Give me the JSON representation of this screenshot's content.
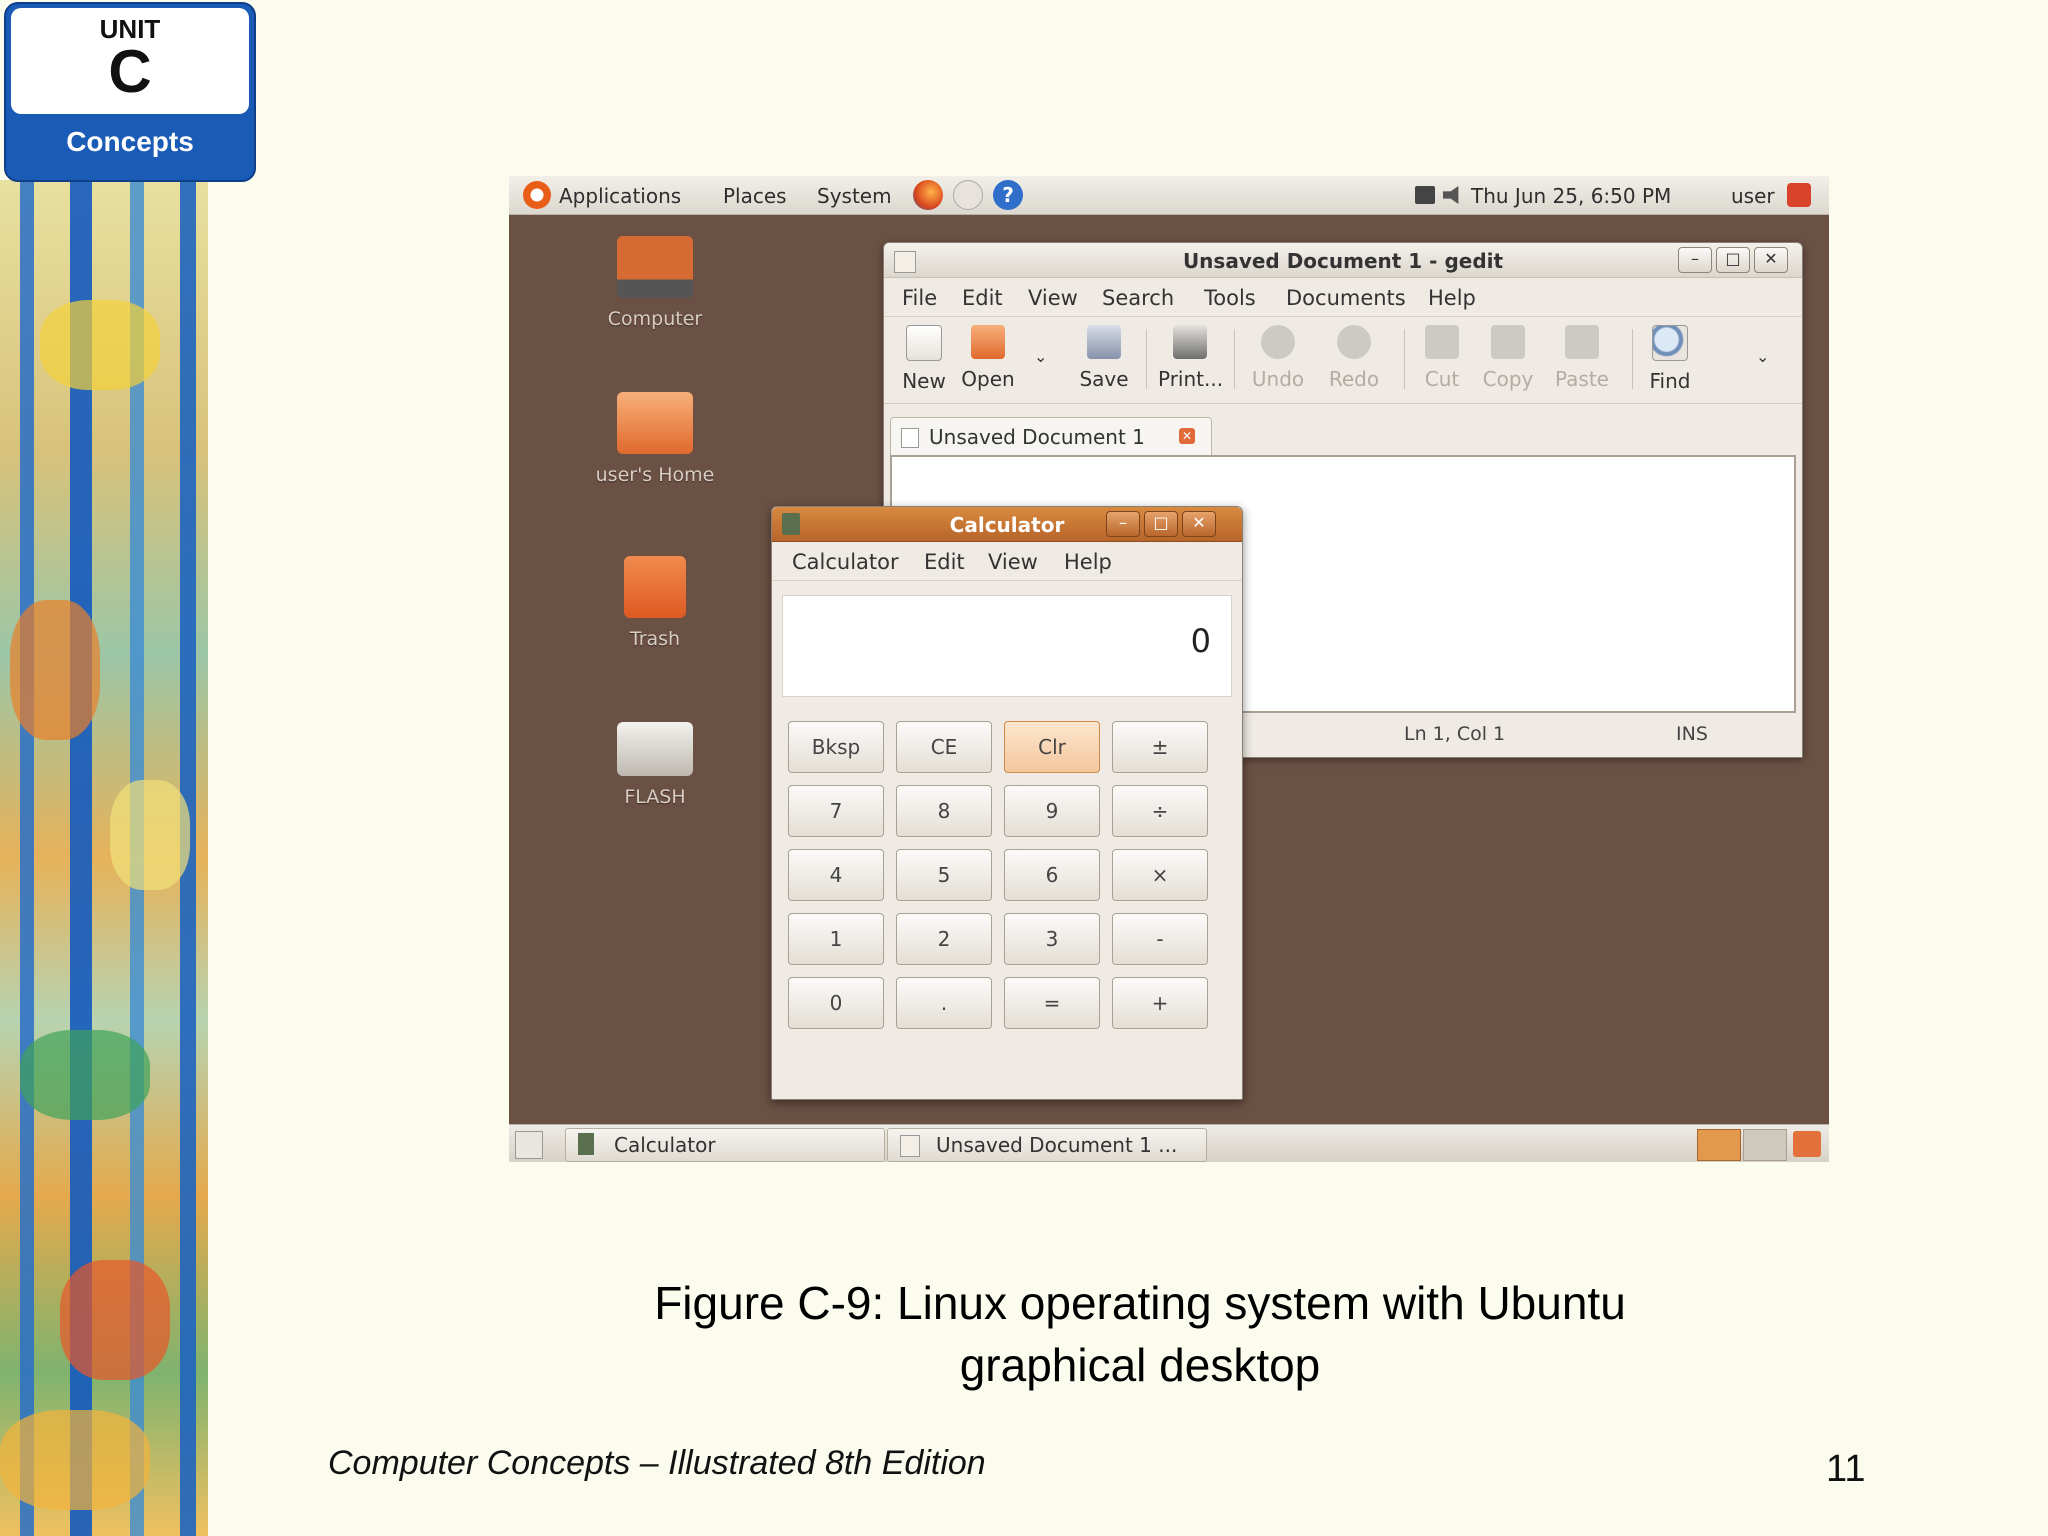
{
  "badge": {
    "unit": "UNIT",
    "letter": "C",
    "label": "Concepts"
  },
  "top_panel": {
    "menus": [
      "Applications",
      "Places",
      "System"
    ],
    "clock": "Thu Jun 25,  6:50 PM",
    "user": "user"
  },
  "desktop_icons": [
    "Computer",
    "user's Home",
    "Trash",
    "FLASH"
  ],
  "gedit": {
    "title": "Unsaved Document 1 - gedit",
    "menu": [
      "File",
      "Edit",
      "View",
      "Search",
      "Tools",
      "Documents",
      "Help"
    ],
    "toolbar": [
      "New",
      "Open",
      "Save",
      "Print...",
      "Undo",
      "Redo",
      "Cut",
      "Copy",
      "Paste",
      "Find"
    ],
    "tab": "Unsaved Document 1",
    "status_position": "Ln 1, Col 1",
    "status_mode": "INS"
  },
  "calculator": {
    "title": "Calculator",
    "menu": [
      "Calculator",
      "Edit",
      "View",
      "Help"
    ],
    "display": "0",
    "keys": [
      [
        "Bksp",
        "CE",
        "Clr",
        "±"
      ],
      [
        "7",
        "8",
        "9",
        "÷"
      ],
      [
        "4",
        "5",
        "6",
        "×"
      ],
      [
        "1",
        "2",
        "3",
        "-"
      ],
      [
        "0",
        ".",
        "=",
        "+"
      ]
    ]
  },
  "taskbar": [
    "Calculator",
    "Unsaved Document 1 ..."
  ],
  "caption": {
    "line1": "Figure C-9: Linux operating system with Ubuntu",
    "line2": "graphical desktop"
  },
  "footer": {
    "book": "Computer Concepts – Illustrated 8th Edition",
    "page": "11"
  },
  "colors": {
    "desktop": "#6b5144",
    "accent_orange": "#d88a40",
    "badge_blue": "#1a5bb6",
    "slide_bg": "#fbfbee"
  }
}
